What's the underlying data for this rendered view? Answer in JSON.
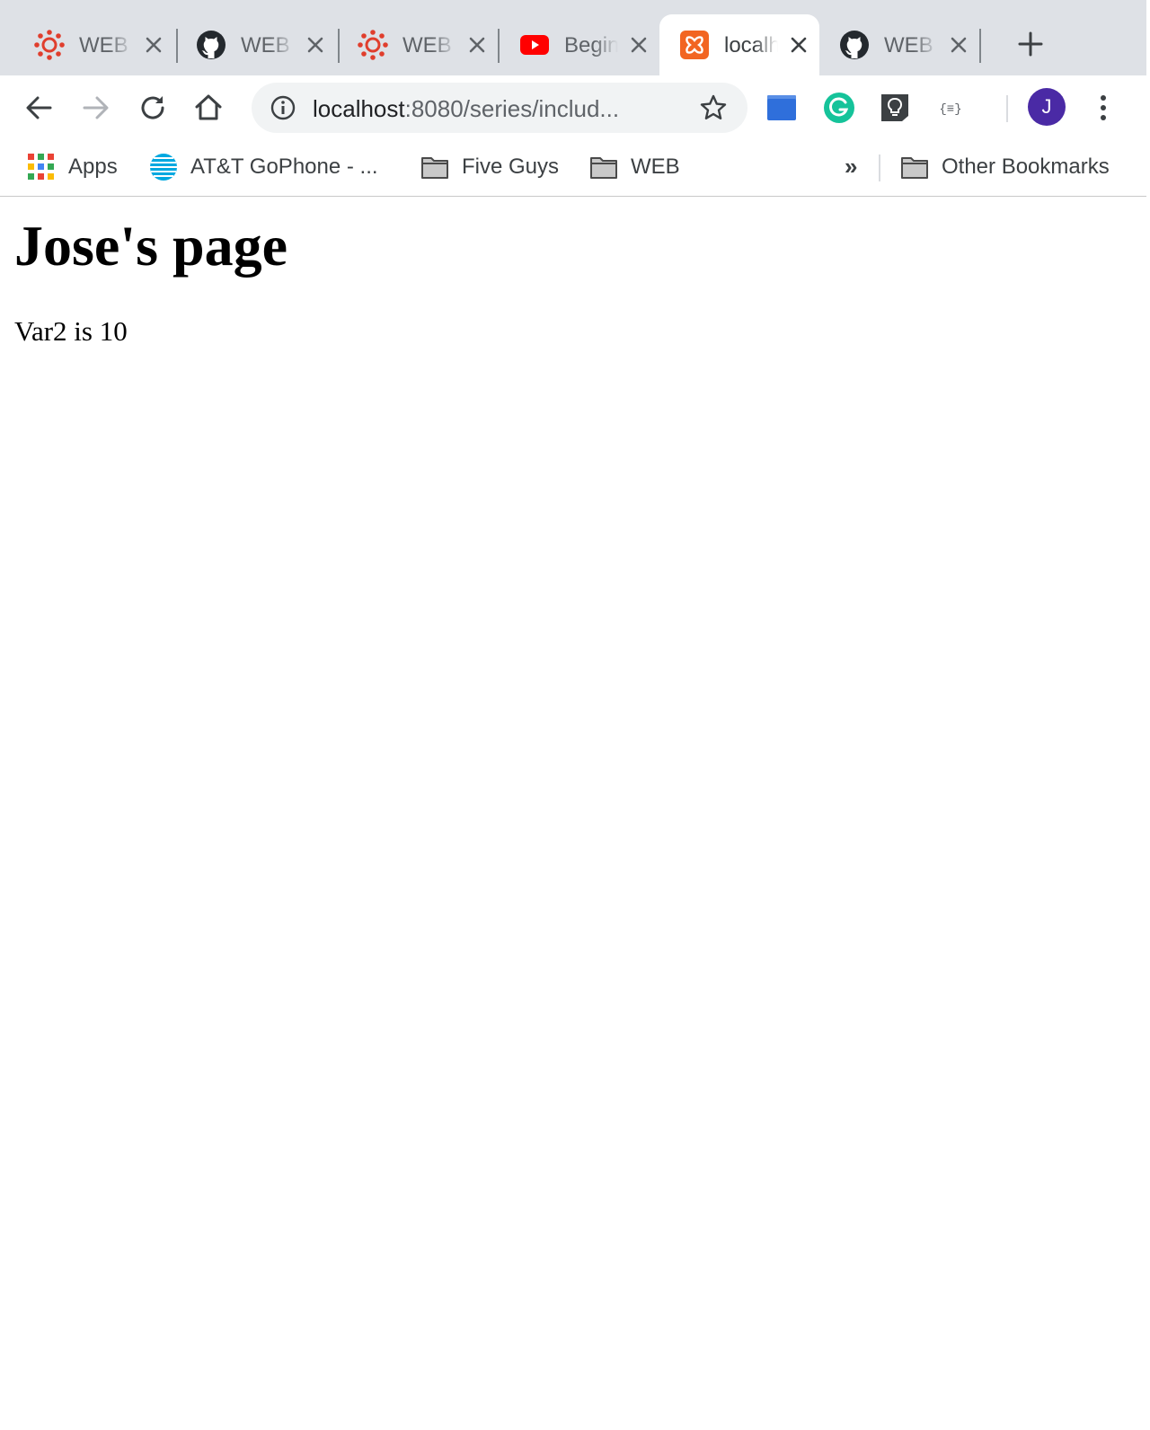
{
  "tabs": [
    {
      "title": "WEB",
      "favicon": "canvas-icon",
      "active": false
    },
    {
      "title": "WEB",
      "favicon": "github-icon",
      "active": false
    },
    {
      "title": "WEB",
      "favicon": "canvas-icon",
      "active": false
    },
    {
      "title": "Beginner",
      "favicon": "youtube-icon",
      "active": false
    },
    {
      "title": "localhost",
      "favicon": "xampp-icon",
      "active": true
    },
    {
      "title": "WEB",
      "favicon": "github-icon",
      "active": false
    }
  ],
  "toolbar": {
    "url_host": "localhost",
    "url_path": ":8080/series/includ...",
    "avatar_initial": "J"
  },
  "bookmarks": {
    "items": [
      {
        "label": "Apps",
        "icon": "apps-grid-icon"
      },
      {
        "label": "AT&T GoPhone - ...",
        "icon": "att-globe-icon"
      },
      {
        "label": "Five Guys",
        "icon": "folder-icon"
      },
      {
        "label": "WEB",
        "icon": "folder-icon"
      }
    ],
    "overflow_label": "»",
    "other_label": "Other Bookmarks"
  },
  "page": {
    "heading": "Jose's page",
    "text": "Var2 is 10"
  },
  "colors": {
    "tabstrip_bg": "#dee1e6",
    "omnibox_bg": "#f1f3f4",
    "avatar_bg": "#4a2aa5",
    "grammarly": "#15c39a",
    "youtube_red": "#ff0000",
    "canvas_red": "#e03e2d",
    "xampp_orange": "#f26522"
  }
}
